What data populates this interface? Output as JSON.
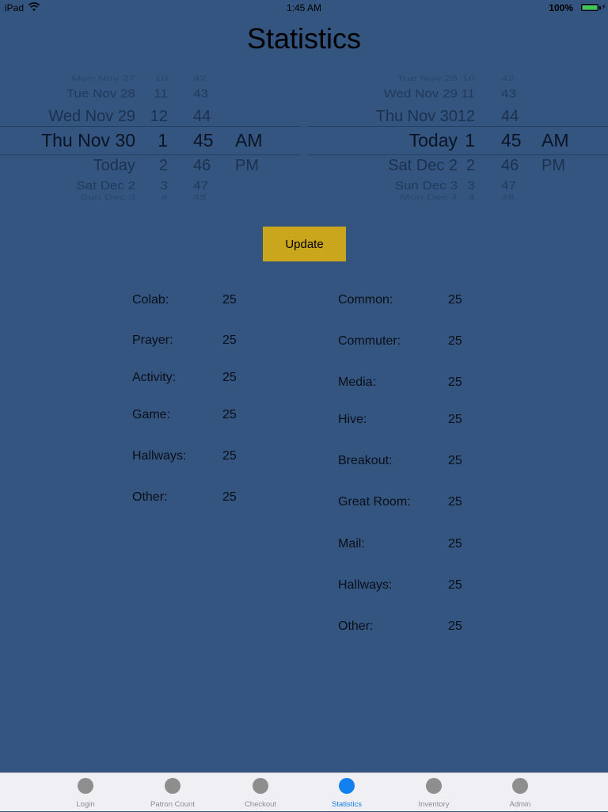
{
  "status_bar": {
    "device": "iPad",
    "time": "1:45 AM",
    "battery": "100%"
  },
  "title": "Statistics",
  "start_picker": {
    "rows": [
      {
        "date": "Mon Nov 27",
        "hour": "10",
        "minute": "42",
        "ampm": ""
      },
      {
        "date": "Tue Nov 28",
        "hour": "11",
        "minute": "43",
        "ampm": ""
      },
      {
        "date": "Wed Nov 29",
        "hour": "12",
        "minute": "44",
        "ampm": ""
      },
      {
        "date": "Thu Nov 30",
        "hour": "1",
        "minute": "45",
        "ampm": "AM"
      },
      {
        "date": "Today",
        "hour": "2",
        "minute": "46",
        "ampm": "PM"
      },
      {
        "date": "Sat Dec 2",
        "hour": "3",
        "minute": "47",
        "ampm": ""
      },
      {
        "date": "Sun Dec 3",
        "hour": "4",
        "minute": "48",
        "ampm": ""
      }
    ]
  },
  "end_picker": {
    "rows": [
      {
        "date": "Tue Nov 28",
        "hour": "10",
        "minute": "42",
        "ampm": ""
      },
      {
        "date": "Wed Nov 29",
        "hour": "11",
        "minute": "43",
        "ampm": ""
      },
      {
        "date": "Thu Nov 30",
        "hour": "12",
        "minute": "44",
        "ampm": ""
      },
      {
        "date": "Today",
        "hour": "1",
        "minute": "45",
        "ampm": "AM"
      },
      {
        "date": "Sat Dec 2",
        "hour": "2",
        "minute": "46",
        "ampm": "PM"
      },
      {
        "date": "Sun Dec 3",
        "hour": "3",
        "minute": "47",
        "ampm": ""
      },
      {
        "date": "Mon Dec 4",
        "hour": "4",
        "minute": "48",
        "ampm": ""
      }
    ]
  },
  "update_button": {
    "label": "Update"
  },
  "stats_left": [
    {
      "label": "Colab:",
      "value": "25"
    },
    {
      "label": "Prayer:",
      "value": "25"
    },
    {
      "label": "Activity:",
      "value": "25"
    },
    {
      "label": "Game:",
      "value": "25"
    },
    {
      "label": "Hallways:",
      "value": "25"
    },
    {
      "label": "Other:",
      "value": "25"
    }
  ],
  "stats_right": [
    {
      "label": "Common:",
      "value": "25"
    },
    {
      "label": "Commuter:",
      "value": "25"
    },
    {
      "label": "Media:",
      "value": "25"
    },
    {
      "label": "Hive:",
      "value": "25"
    },
    {
      "label": "Breakout:",
      "value": "25"
    },
    {
      "label": "Great Room:",
      "value": "25"
    },
    {
      "label": "Mail:",
      "value": "25"
    },
    {
      "label": "Hallways:",
      "value": "25"
    },
    {
      "label": "Other:",
      "value": "25"
    }
  ],
  "tabs": [
    {
      "label": "Login",
      "active": false
    },
    {
      "label": "Patron Count",
      "active": false
    },
    {
      "label": "Checkout",
      "active": false
    },
    {
      "label": "Statistics",
      "active": true
    },
    {
      "label": "Inventory",
      "active": false
    },
    {
      "label": "Admin",
      "active": false
    }
  ],
  "colors": {
    "background": "#33557f",
    "accent": "#c9a61c",
    "tab_active": "#1280ef",
    "tab_inactive": "#8e8e8e"
  }
}
